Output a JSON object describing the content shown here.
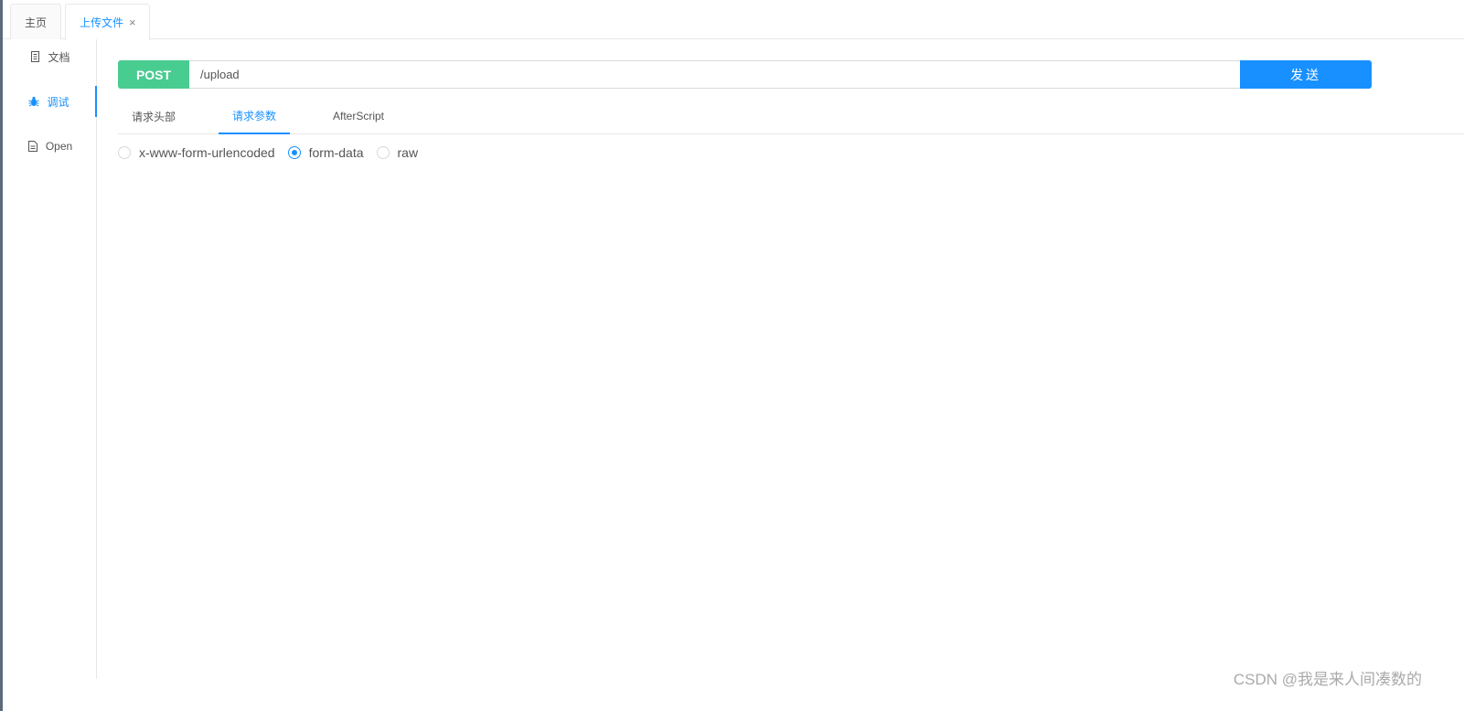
{
  "top_tabs": [
    {
      "label": "主页",
      "active": false
    },
    {
      "label": "上传文件",
      "active": true,
      "close": "×"
    }
  ],
  "side_nav": {
    "items": [
      {
        "label": "文档",
        "icon": "document-icon",
        "active": false
      },
      {
        "label": "调试",
        "icon": "bug-icon",
        "active": true
      },
      {
        "label": "Open",
        "icon": "file-icon",
        "active": false
      }
    ]
  },
  "request": {
    "method": "POST",
    "url": "/upload",
    "send_label": "发送"
  },
  "sub_tabs": [
    {
      "label": "请求头部",
      "active": false
    },
    {
      "label": "请求参数",
      "active": true
    },
    {
      "label": "AfterScript",
      "active": false
    }
  ],
  "body_types": {
    "options": [
      "x-www-form-urlencoded",
      "form-data",
      "raw"
    ],
    "selected": "form-data"
  },
  "watermark": "CSDN @我是来人间凑数的",
  "colors": {
    "accent": "#1890ff",
    "method_post": "#49cc90",
    "border": "#e8e8e8"
  }
}
